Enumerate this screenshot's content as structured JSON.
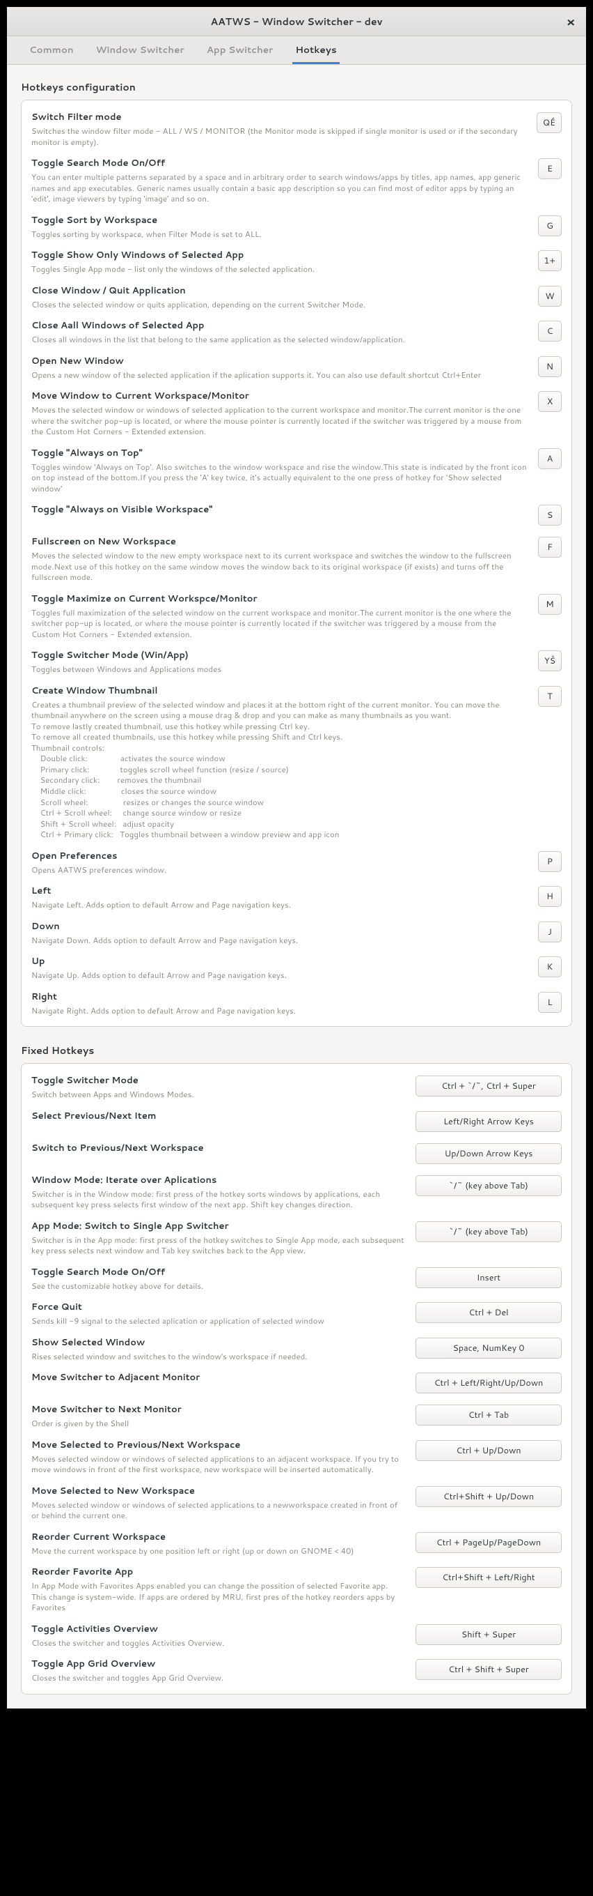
{
  "window": {
    "title": "AATWS - Window Switcher - dev"
  },
  "tabs": {
    "common": "Common",
    "window_switcher": "Window Switcher",
    "app_switcher": "App Switcher",
    "hotkeys": "Hotkeys"
  },
  "section1": "Hotkeys configuration",
  "cfg": [
    {
      "t": "Switch Filter mode",
      "d": "Switches the window filter mode - ALL / WS / MONITOR (the Monitor mode is skipped if single monitor is used or if the secondary monitor is empty).",
      "k": "QÉ"
    },
    {
      "t": "Toggle Search Mode On/Off",
      "d": "You can enter multiple patterns separated by a space and in arbitrary order to search windows/apps by titles, app names, app generic names and app executables. Generic names usually contain a basic app description so you can find most of editor apps by typing an 'edit', image viewers by typing 'image' and so on.",
      "k": "E"
    },
    {
      "t": "Toggle Sort by Workspace",
      "d": "Toggles sorting by workspace, when Filter Mode is set to ALL.",
      "k": "G"
    },
    {
      "t": "Toggle Show Only Windows of Selected App",
      "d": "Toggles Single App mode - list only the windows of the selected application.",
      "k": "1+"
    },
    {
      "t": "Close Window / Quit Application",
      "d": "Closes the selected window or quits application, depending on the current Switcher Mode.",
      "k": "W"
    },
    {
      "t": "Close Aall Windows of Selected App",
      "d": "Closes all windows in the list that belong to the same application as the selected window/application.",
      "k": "C"
    },
    {
      "t": "Open New Window",
      "d": "Opens a new window of the selected application if the aplication supports it. You can also use default shortcut Ctrl+Enter",
      "k": "N"
    },
    {
      "t": "Move Window to Current Workspace/Monitor",
      "d": "Moves the selected window or windows of selected application to the current workspace and monitor.The current monitor is the one where the switcher pop-up is located, or where the mouse pointer is currently located if the switcher was triggered by a mouse from the Custom Hot Corners - Extended extension.",
      "k": "X"
    },
    {
      "t": "Toggle \"Always on Top\"",
      "d": "Toggles window 'Always on Top'. Also switches to the window workspace and rise the window.This state is indicated by the front icon on top instead of the bottom.If you press the 'A' key twice, it's actually equivalent to the one press of hotkey for 'Show selected window'",
      "k": "A"
    },
    {
      "t": "Toggle \"Always on Visible Workspace\"",
      "d": "",
      "k": "S"
    },
    {
      "t": "Fullscreen on New Workspace",
      "d": "Moves the selected window to the new empty workspace next to its current workspace and switches the window to the fullscreen mode.Next use of this hotkey on the same window moves the window back to its original workspace (if exists) and turns off the fullscreen mode.",
      "k": "F"
    },
    {
      "t": "Toggle Maximize on Current Workspce/Monitor",
      "d": "Toggles full maximization of the selected window on the current workspace and monitor.The current monitor is the one where the switcher pop-up is located, or where the mouse pointer is currently located if the switcher was triggered by a mouse from the Custom Hot Corners - Extended extension.",
      "k": "M"
    },
    {
      "t": "Toggle Switcher Mode (Win/App)",
      "d": "Toggles between Windows and Applications modes",
      "k": "YŠ"
    },
    {
      "t": "Create Window Thumbnail",
      "d": "Creates a thumbnail preview of the selected window and places it at the bottom right of the current monitor. You can move the thumbnail anywhere on the screen using a mouse drag & drop and you can make as many thumbnails as you want.\nTo remove lastly created thumbnail, use this hotkey while pressing Ctrl key.\nTo remove all created thumbnails, use this hotkey while pressing Shift and Ctrl keys.\nThumbnail controls:\n    Double click:               activates the source window\n    Primary click:              toggles scroll wheel function (resize / source)\n    Secondary click:        removes the thumbnail\n    Middle click:                closes the source window\n    Scroll wheel:                resizes or changes the source window\n    Ctrl + Scroll wheel:     change source window or resize\n    Shift + Scroll wheel:   adjust opacity\n    Ctrl + Primary click:   Toggles thumbnail between a window preview and app icon",
      "k": "T"
    },
    {
      "t": "Open Preferences",
      "d": "Opens AATWS preferences window.",
      "k": "P"
    },
    {
      "t": "Left",
      "d": "Navigate Left. Adds option to default Arrow and Page navigation keys.",
      "k": "H"
    },
    {
      "t": "Down",
      "d": "Navigate Down. Adds option to default Arrow and Page navigation keys.",
      "k": "J"
    },
    {
      "t": "Up",
      "d": "Navigate Up. Adds option to default Arrow and Page navigation keys.",
      "k": "K"
    },
    {
      "t": "Right",
      "d": "Navigate Right. Adds option to default Arrow and Page navigation keys.",
      "k": "L"
    }
  ],
  "section2": "Fixed Hotkeys",
  "fixed": [
    {
      "t": "Toggle Switcher Mode",
      "d": "Switch between Apps and Windows Modes.",
      "k": "Ctrl + `/~, Ctrl + Super"
    },
    {
      "t": "Select Previous/Next Item",
      "d": "",
      "k": "Left/Right Arrow Keys"
    },
    {
      "t": "Switch to Previous/Next Workspace",
      "d": "",
      "k": "Up/Down Arrow Keys"
    },
    {
      "t": "Window Mode: Iterate over Aplications",
      "d": "Switcher is in the Window mode: first press of the hotkey sorts windows by applications, each subsequent key press selects first window of the next app. Shift key changes direction.",
      "k": "`/~ (key above Tab)"
    },
    {
      "t": "App Mode: Switch to Single App Switcher",
      "d": "Switcher is in the App mode: first press of the hotkey switches to Single App mode, each subsequent key press selects next window and Tab key switches back to the App view.",
      "k": "`/~ (key above Tab)"
    },
    {
      "t": "Toggle Search Mode On/Off",
      "d": "See the customizable hotkey above for details.",
      "k": "Insert"
    },
    {
      "t": "Force Quit",
      "d": "Sends kill -9 signal to the selected aplication or application of selected window",
      "k": "Ctrl + Del"
    },
    {
      "t": "Show Selected Window",
      "d": "Rises selected window and switches to the window's workspace if needed.",
      "k": "Space, NumKey 0"
    },
    {
      "t": "Move Switcher to Adjacent Monitor",
      "d": "",
      "k": "Ctrl + Left/Right/Up/Down"
    },
    {
      "t": "Move Switcher to Next Monitor",
      "d": "Order is given by the Shell",
      "k": "Ctrl + Tab"
    },
    {
      "t": "Move Selected to Previous/Next Workspace",
      "d": "Moves selected window or windows of selected applications to an adjacent workspace. If you try to move windows in front of the first workspace, new workspace will be inserted automatically.",
      "k": "Ctrl + Up/Down"
    },
    {
      "t": "Move Selected to New Workspace",
      "d": "Moves selected window or windows of selected applications to a newworkspace created in front of or behind the current one.",
      "k": "Ctrl+Shift + Up/Down"
    },
    {
      "t": "Reorder Current Workspace",
      "d": "Move the current workspace by one position left or right (up or down on GNOME < 40)",
      "k": "Ctrl + PageUp/PageDown"
    },
    {
      "t": "Reorder Favorite App",
      "d": "In App Mode with Favorites Apps enabled you can change the possition of selected Favorite app. This change is system-wide.\nIf apps are ordered by MRU, first pres of the hotkey reorders apps by Favorites",
      "k": "Ctrl+Shift + Left/Right"
    },
    {
      "t": "Toggle Activities Overview",
      "d": "Closes the switcher and toggles Activities Overview.",
      "k": "Shift + Super"
    },
    {
      "t": "Toggle App Grid Overview",
      "d": "Closes the switcher and toggles App Grid Overview.",
      "k": "Ctrl + Shift + Super"
    }
  ]
}
